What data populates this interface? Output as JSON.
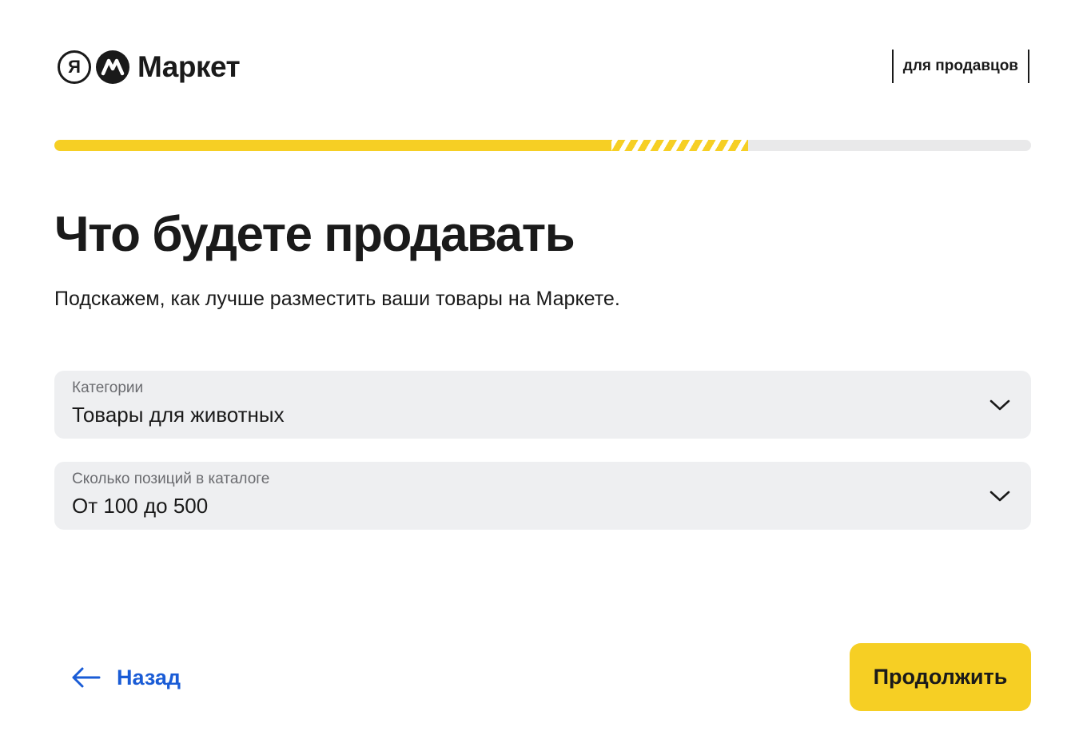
{
  "header": {
    "logo_ya": "Я",
    "logo_text": "Маркет",
    "sellers_tag": "для продавцов"
  },
  "progress": {
    "completed_fraction": 0.57,
    "in_progress_fraction": 0.14
  },
  "main": {
    "title": "Что будете продавать",
    "subtitle": "Подскажем, как лучше разместить ваши товары на Маркете."
  },
  "fields": [
    {
      "label": "Категории",
      "value": "Товары для животных",
      "icon": "chevron-down-icon"
    },
    {
      "label": "Сколько позиций в каталоге",
      "value": "От 100 до 500",
      "icon": "chevron-down-icon"
    }
  ],
  "footer": {
    "back_label": "Назад",
    "continue_label": "Продолжить"
  },
  "colors": {
    "accent": "#f6cf24",
    "link": "#1a5cd6",
    "field_bg": "#eeeff1",
    "track": "#e9e9ea"
  }
}
